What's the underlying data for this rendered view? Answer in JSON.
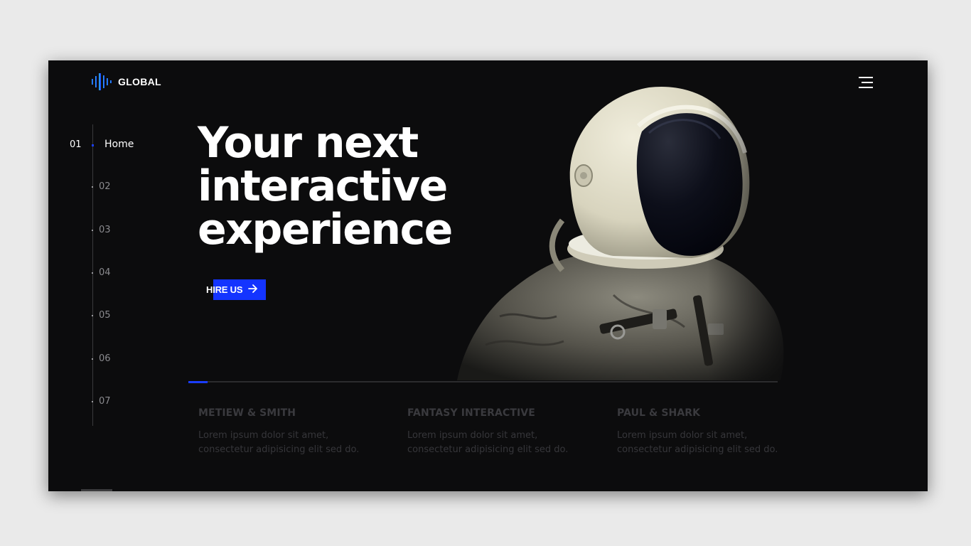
{
  "brand": {
    "name": "GLOBAL",
    "logo_icon": "sound-wave-icon",
    "colors": {
      "gradient_start": "#2fb6ff",
      "gradient_end": "#1a3dff"
    }
  },
  "header": {
    "menu_icon": "hamburger-menu-icon"
  },
  "side_nav": {
    "active_index": 0,
    "items": [
      {
        "number": "01",
        "label": "Home"
      },
      {
        "number": "02",
        "label": ""
      },
      {
        "number": "03",
        "label": ""
      },
      {
        "number": "04",
        "label": ""
      },
      {
        "number": "05",
        "label": ""
      },
      {
        "number": "06",
        "label": ""
      },
      {
        "number": "07",
        "label": ""
      }
    ]
  },
  "hero": {
    "title_lines": [
      "Your next",
      "interactive",
      "experience"
    ],
    "cta_label": "HIRE US",
    "cta_icon": "arrow-right-icon",
    "cta_color": "#1434ff",
    "image": "astronaut-photo"
  },
  "progress": {
    "fraction": 0.033,
    "color": "#1a3dff"
  },
  "clients": [
    {
      "name": "METIEW & SMITH",
      "desc_line1": "Lorem ipsum dolor sit amet,",
      "desc_line2": "consectetur adipisicing elit sed do."
    },
    {
      "name": "FANTASY INTERACTIVE",
      "desc_line1": "Lorem ipsum dolor sit amet,",
      "desc_line2": "consectetur adipisicing elit sed do."
    },
    {
      "name": "PAUL & SHARK",
      "desc_line1": "Lorem ipsum dolor sit amet,",
      "desc_line2": "consectetur adipisicing elit sed do."
    }
  ]
}
